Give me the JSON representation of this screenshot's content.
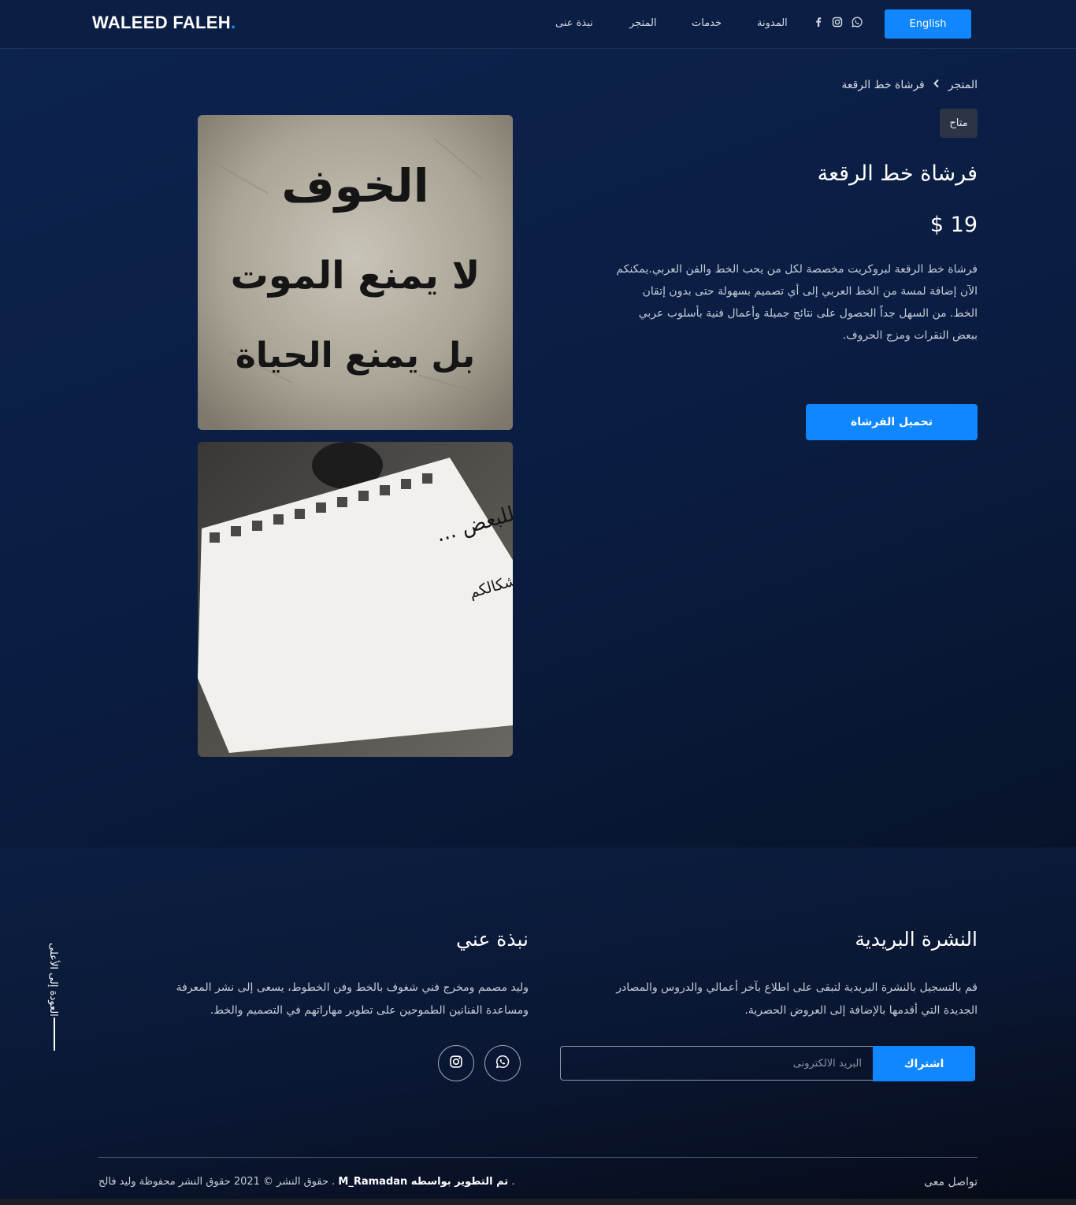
{
  "header": {
    "logo": "WALEED FALEH",
    "logo_dot": ".",
    "nav": [
      "نبذة عنى",
      "المتجر",
      "خدمات",
      "المدونة"
    ],
    "social_icons": [
      "facebook-icon",
      "instagram-icon",
      "whatsapp-icon"
    ],
    "language_button": "English"
  },
  "breadcrumb": {
    "root": "المتجر",
    "current": "فرشاة خط الرقعة"
  },
  "product": {
    "badge": "متاح",
    "title": "فرشاة خط الرقعة",
    "price": "19 $",
    "description_lines": [
      "فرشاة خط الرقعة لبروكريت مخصصة لكل من يحب الخط والفن العربي.يمكنكم",
      "الآن إضافة لمسة من الخط العربي إلى أي تصميم بسهولة حتى بدون إتقان",
      "الخط. من السهل جداً الحصول على نتائج جميلة وأعمال فنية بأسلوب عربي",
      "ببعض النقرات ومزج الحروف."
    ],
    "download_button": "تحميل الفرشاة",
    "image1_text": [
      "الخوف",
      "لا يمنع الموت",
      "بل يمنع الحياة"
    ],
    "image2_text": [
      "للبعض ...",
      "كم نتمنى أن تشبه نواياكم أشكالكم"
    ]
  },
  "footer": {
    "newsletter": {
      "title": "النشرة البريدية",
      "text_lines": [
        "قم بالتسجيل بالنشرة البريدية لتبقى على اطلاع بآخر أعمالي والدروس والمصادر",
        "الجديدة التي أقدمها بالإضافة إلى العروض الحصرية."
      ],
      "email_placeholder": "البريد الالكترونى",
      "subscribe_button": "اشتراك"
    },
    "about": {
      "title": "نبذة عني",
      "text_lines": [
        "وليد مصمم ومخرج فني شغوف بالخط وفن الخطوط، يسعى إلى نشر المعرفة",
        "ومساعدة الفنانين الطموحين على تطوير مهاراتهم في التصميم والخط."
      ],
      "social_icons": [
        "whatsapp-icon",
        "instagram-icon"
      ]
    },
    "back_to_top": "العودة إلى الأعلى",
    "copyright_prefix": ". حقوق النشر © 2021 حقوق النشر محفوظة وليد فالح",
    "developer_credit": "تم التطوير بواسطه M_Ramadan",
    "copyright_suffix": ".",
    "contact_label": "تواصل معى"
  },
  "colors": {
    "accent": "#1087ff",
    "background": "#0b1f45",
    "badge_bg": "#2c3446"
  }
}
